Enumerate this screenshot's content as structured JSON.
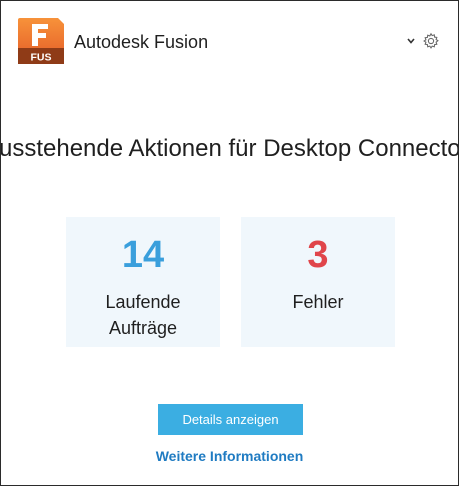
{
  "header": {
    "app_icon": {
      "name": "fusion-app-icon",
      "letter": "F",
      "badge": "FUS",
      "color_top": "#f5822a",
      "color_bottom": "#e0552a",
      "badge_color": "#8a3a1a"
    },
    "app_name": "Autodesk Fusion",
    "dropdown_icon": "chevron-down-icon",
    "settings_icon": "gear-icon"
  },
  "main": {
    "title": "usstehende Aktionen für Desktop Connecto",
    "stats": [
      {
        "value": "14",
        "label_line1": "Laufende",
        "label_line2": "Aufträge",
        "color": "#3a9fdc"
      },
      {
        "value": "3",
        "label": "Fehler",
        "color": "#e0454a"
      }
    ],
    "details_button": "Details anzeigen",
    "more_info_link": "Weitere Informationen"
  },
  "colors": {
    "accent": "#3baee2",
    "link": "#1f7bc2",
    "card_bg": "#f0f7fc"
  }
}
